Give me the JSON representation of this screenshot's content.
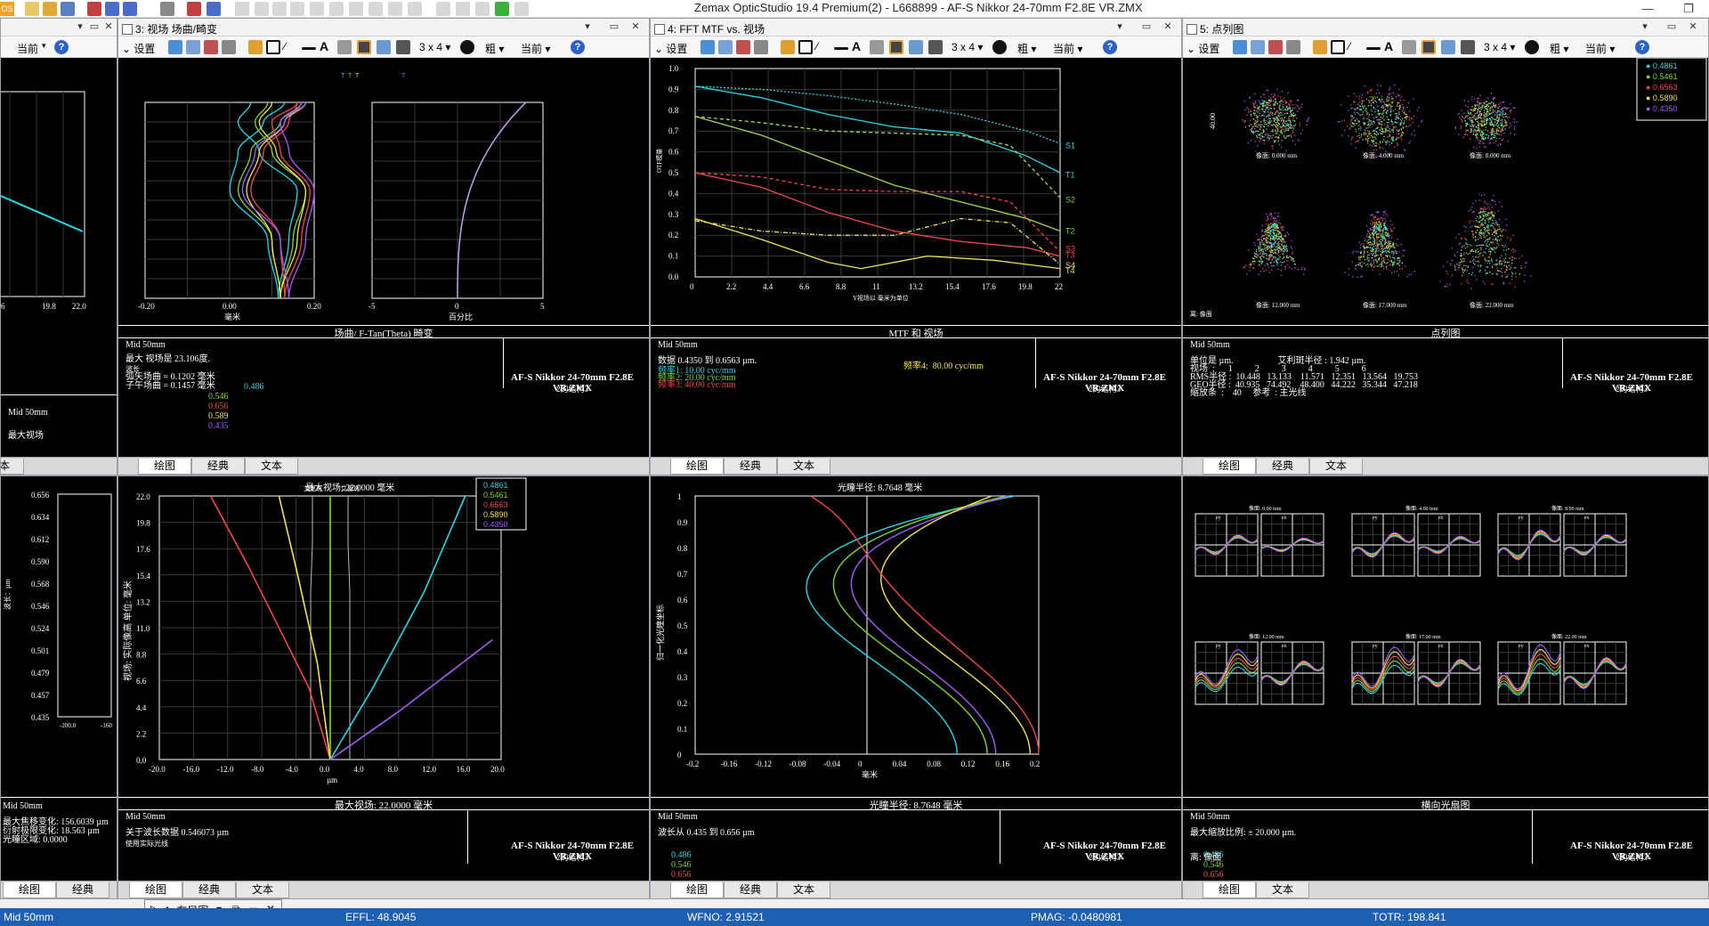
{
  "app": {
    "title": "Zemax OpticStudio 19.4    Premium(2) - L668899 - AF-S Nikkor 24-70mm F2.8E VR.ZMX",
    "icon_label": "OS"
  },
  "common": {
    "settings": "设置",
    "grid": "3 x 4",
    "coarse": "粗",
    "current": "当前",
    "help": "?",
    "config": "Mid 50mm",
    "lens": "AF-S Nikkor 24-70mm F2.8E VR.ZMX",
    "config_of": "2的结构3",
    "wavelengths": [
      "0.486",
      "0.546",
      "0.656",
      "0.589",
      "0.435"
    ],
    "wavelength_colors": [
      "#27d7e6",
      "#7dd82e",
      "#f1484c",
      "#f2e44a",
      "#a55cf5"
    ],
    "tabs": [
      "绘图",
      "经典",
      "文本"
    ]
  },
  "panels": {
    "p1": {
      "x_ticks": [
        "6",
        "19.8",
        "22.0"
      ],
      "footer_info": "Mid 50mm",
      "footer_extra": "最大视场"
    },
    "p3": {
      "title": "3: 视场 场曲/畸变",
      "footer_title": "场曲/ F-Tan(Theta) 畸变",
      "x_ticks_left": [
        "-0.20",
        "0.00",
        "0.20"
      ],
      "x_unit_left": "毫米",
      "x_ticks_right": [
        "-5",
        "0",
        "5"
      ],
      "x_unit_right": "百分比",
      "info_lines": [
        "Mid 50mm",
        "",
        "最大 视场是 23.106度.",
        "波长",
        "弧矢场曲 = 0.1202 毫米",
        "子午场曲 = 0.1457 毫米"
      ]
    },
    "p4": {
      "title": "4: FFT MTF vs. 视场",
      "footer_title": "MTF 和 视场",
      "y_ticks": [
        "1.0",
        "0.9",
        "0.8",
        "0.7",
        "0.6",
        "0.5",
        "0.4",
        "0.3",
        "0.2",
        "0.1",
        "0.0"
      ],
      "x_ticks": [
        "0",
        "2.2",
        "4.4",
        "6.6",
        "8.8",
        "11",
        "13.2",
        "15.4",
        "17.6",
        "19.8",
        "22"
      ],
      "y_label": "OTF模量",
      "x_label": "Y视场以 毫米为单位",
      "series_labels": [
        "S1",
        "T1",
        "S2",
        "T2",
        "S3",
        "T3",
        "S4",
        "T4"
      ],
      "info_lines": [
        "Mid 50mm",
        "",
        "数据 0.4350 到 0.6563 µm.",
        "频率1: 10.00 cyc/mm",
        "频率2: 20.00 cyc/mm",
        "频率3: 40.00 cyc/mm"
      ],
      "freq4": "频率4:  80.00 cyc/mm"
    },
    "p5": {
      "title": "5: 点列图",
      "footer_title": "点列图",
      "legend": [
        "0.4861",
        "0.5461",
        "0.6563",
        "0.5890",
        "0.4350"
      ],
      "field_labels": [
        "像面: 0.000 mm",
        "像面: 4.000 mm",
        "像面: 8.000 mm",
        "像面: 12.000 mm",
        "像面: 17.000 mm",
        "像面: 22.000 mm"
      ],
      "scale_label": "40.00",
      "corner_label": "离: 像面",
      "info_lines": [
        "Mid 50mm",
        "",
        "单位是 µm.                    艾利斑半径 : 1.942 µm.",
        "视场  :      1          2          3          4          5          6",
        "RMS半径 :  10.448   13.133    11.571   12.351   13.564   19.753",
        "GEO半径 :  40.935   74.492    48.400   44.222   35.344   47.218",
        "缩放条  :    40     参考  : 主光线"
      ]
    },
    "p_bl": {
      "y_ticks": [
        "0.656",
        "0.634",
        "0.612",
        "0.590",
        "0.568",
        "0.546",
        "0.524",
        "0.501",
        "0.479",
        "0.457",
        "0.435"
      ],
      "y_label": "波长：µm",
      "x_ticks": [
        "-200.0",
        "-160"
      ],
      "info_lines": [
        "Mid 50mm",
        "",
        "最大焦移变化: 156.6039 µm",
        "衍射极限变化: 18.563 µm",
        "光瞳区域: 0.0000"
      ]
    },
    "p_lat": {
      "header": "最大视场: 22.0000 毫米",
      "footer_title": "最大视场: 22.0000 毫米",
      "y_ticks": [
        "22.0",
        "19.8",
        "17.6",
        "15.4",
        "13.2",
        "11.0",
        "8.8",
        "6.6",
        "4.4",
        "2.2",
        "0.0"
      ],
      "x_ticks": [
        "-20.0",
        "-16.0",
        "-12.0",
        "-8.0",
        "-4.0",
        "0.0",
        "4.0",
        "8.0",
        "12.0",
        "16.0",
        "20.0"
      ],
      "x_unit": "µm",
      "y_label": "视场: 实际像高 单位: 毫米",
      "airy_labels": [
        "艾里斑",
        "艾里斑"
      ],
      "legend": [
        "0.4861",
        "0.5461",
        "0.6563",
        "0.5890",
        "0.4350"
      ],
      "info_lines": [
        "Mid 50mm",
        "",
        "关于波长数据 0.546073 µm",
        "使用实际光线"
      ]
    },
    "p_lon": {
      "header": "光瞳半径: 8.7648 毫米",
      "footer_title": "光瞳半径: 8.7648 毫米",
      "y_ticks": [
        "1",
        "0.9",
        "0.8",
        "0.7",
        "0.6",
        "0.5",
        "0.4",
        "0.3",
        "0.2",
        "0.1",
        "0"
      ],
      "x_ticks": [
        "-0.2",
        "-0.16",
        "-0.12",
        "-0.08",
        "-0.04",
        "0",
        "0.04",
        "0.08",
        "0.12",
        "0.16",
        "0.2"
      ],
      "x_unit": "毫米",
      "y_label": "归一化光瞳坐标",
      "info_lines": [
        "Mid 50mm",
        "",
        "波长从 0.435 到 0.656 µm"
      ]
    },
    "p_ray": {
      "footer_title": "横向光扇图",
      "field_labels": [
        "像面: 0.00 mm",
        "像面: 4.00 mm",
        "像面: 8.00 mm",
        "像面: 12.00 mm",
        "像面: 17.00 mm",
        "像面: 22.00 mm"
      ],
      "axis_labels": [
        "ey",
        "ex",
        "Py",
        "Px"
      ],
      "info_lines": [
        "Mid 50mm",
        "",
        "最大缩放比例: ± 20.000 µm."
      ],
      "corner_label": "离: 像面"
    }
  },
  "layout_tab": {
    "label": "1: 布局图"
  },
  "status": {
    "config": "Mid 50mm",
    "effl": "EFFL: 48.9045",
    "wfno": "WFNO: 2.91521",
    "pmag": "PMAG: -0.0480981",
    "totr": "TOTR: 198.841"
  }
}
